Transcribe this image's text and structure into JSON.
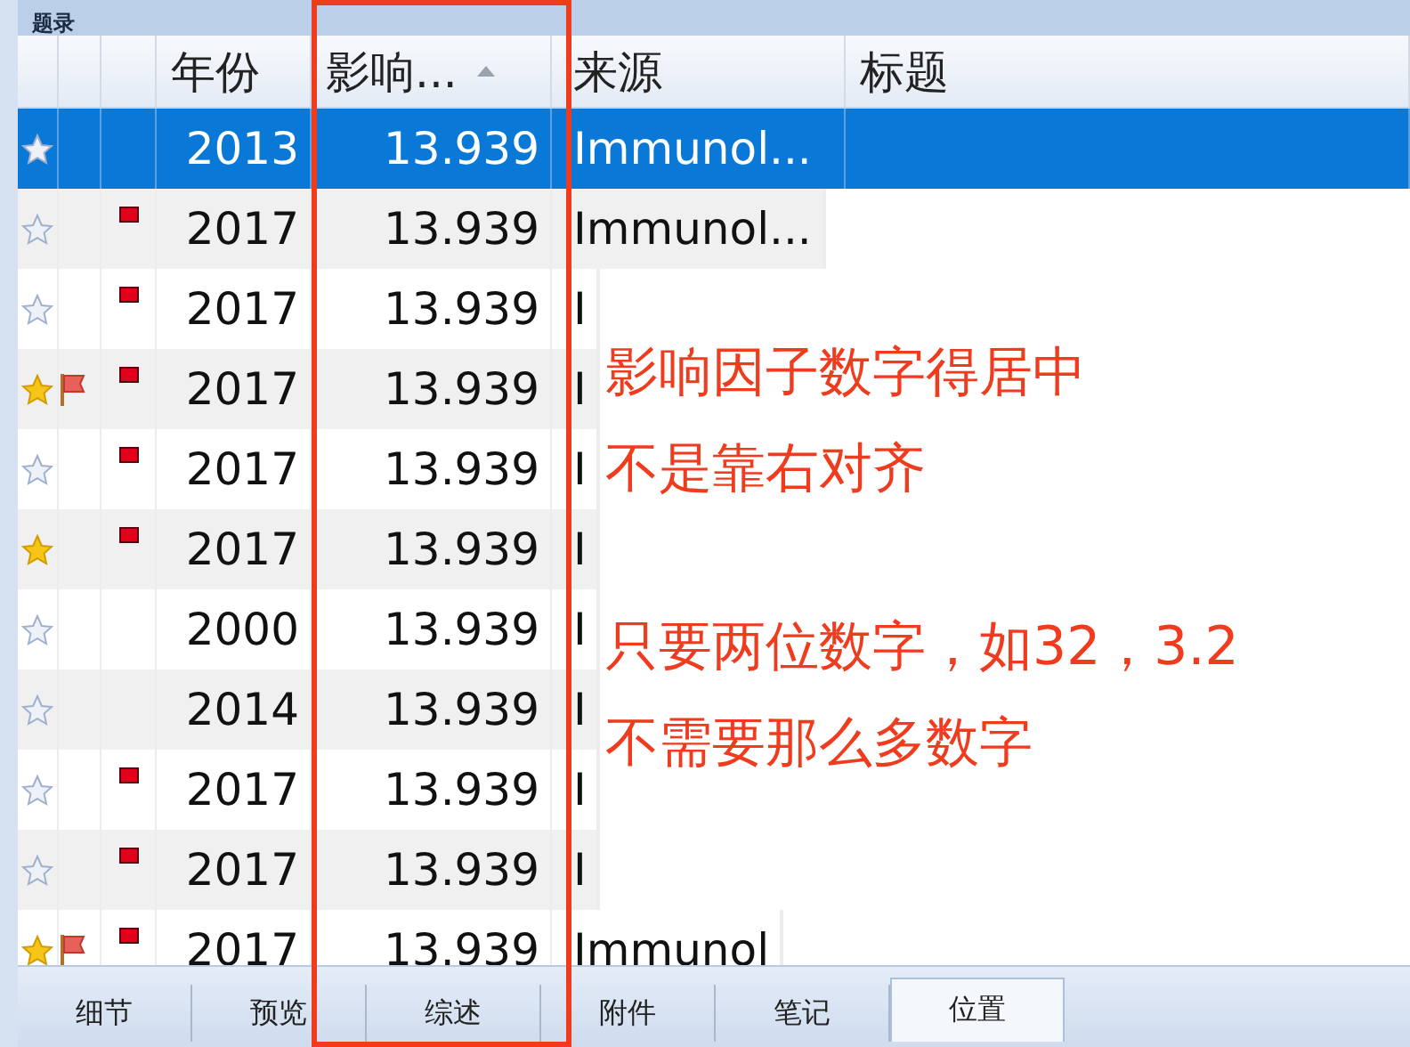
{
  "panel": {
    "title": "题录"
  },
  "table": {
    "columns": [
      {
        "kind": "star"
      },
      {
        "kind": "flag"
      },
      {
        "kind": "mark"
      },
      {
        "label": "年份",
        "kind": "year"
      },
      {
        "label": "影响...",
        "kind": "impact",
        "sorted": true
      },
      {
        "label": "来源",
        "kind": "source"
      },
      {
        "label": "标题",
        "kind": "title"
      }
    ],
    "rows": [
      {
        "selected": true,
        "starred": false,
        "flagged": false,
        "marked": false,
        "year": "2013",
        "impact": "13.939",
        "source": "Immunol..."
      },
      {
        "selected": false,
        "starred": false,
        "flagged": false,
        "marked": true,
        "year": "2017",
        "impact": "13.939",
        "source": "Immunol..."
      },
      {
        "selected": false,
        "starred": false,
        "flagged": false,
        "marked": true,
        "year": "2017",
        "impact": "13.939",
        "source": "I"
      },
      {
        "selected": false,
        "starred": true,
        "flagged": true,
        "marked": true,
        "year": "2017",
        "impact": "13.939",
        "source": "I"
      },
      {
        "selected": false,
        "starred": false,
        "flagged": false,
        "marked": true,
        "year": "2017",
        "impact": "13.939",
        "source": "I"
      },
      {
        "selected": false,
        "starred": true,
        "flagged": false,
        "marked": true,
        "year": "2017",
        "impact": "13.939",
        "source": "I"
      },
      {
        "selected": false,
        "starred": false,
        "flagged": false,
        "marked": false,
        "year": "2000",
        "impact": "13.939",
        "source": "I"
      },
      {
        "selected": false,
        "starred": false,
        "flagged": false,
        "marked": false,
        "year": "2014",
        "impact": "13.939",
        "source": "I"
      },
      {
        "selected": false,
        "starred": false,
        "flagged": false,
        "marked": true,
        "year": "2017",
        "impact": "13.939",
        "source": "I"
      },
      {
        "selected": false,
        "starred": false,
        "flagged": false,
        "marked": true,
        "year": "2017",
        "impact": "13.939",
        "source": "I"
      },
      {
        "selected": false,
        "starred": true,
        "flagged": true,
        "marked": true,
        "year": "2017",
        "impact": "13.939",
        "source": "Immunol"
      }
    ]
  },
  "tabs": [
    {
      "label": "细节",
      "selected": false
    },
    {
      "label": "预览",
      "selected": false
    },
    {
      "label": "综述",
      "selected": false
    },
    {
      "label": "附件",
      "selected": false
    },
    {
      "label": "笔记",
      "selected": false
    },
    {
      "label": "位置",
      "selected": true
    }
  ],
  "annotation_groups": [
    {
      "lines": [
        "影响因子数字得居中",
        "不是靠右对齐"
      ]
    },
    {
      "lines": [
        "只要两位数字，如32，3.2",
        "不需要那么多数字"
      ]
    }
  ]
}
